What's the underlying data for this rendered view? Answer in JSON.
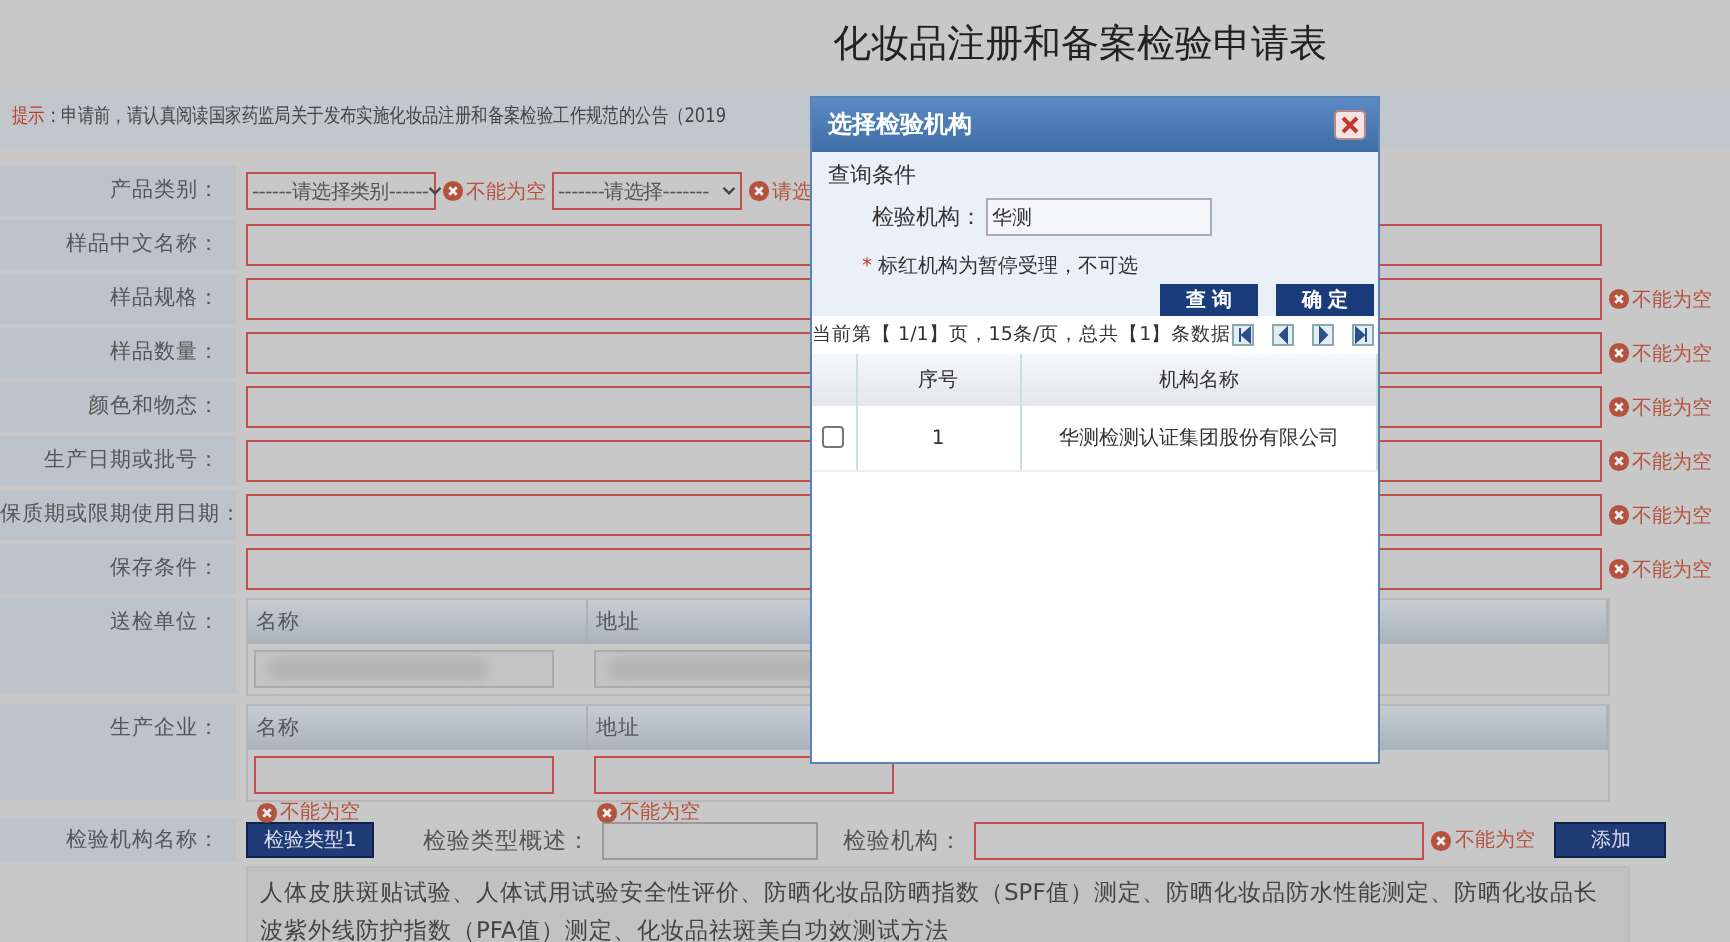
{
  "title": "化妆品注册和备案检验申请表",
  "notice": {
    "label": "提示",
    "text": "：申请前，请认真阅读国家药监局关于发布实施化妆品注册和备案检验工作规范的公告（2019"
  },
  "form_rows": [
    {
      "kind": "selects",
      "label": "产品类别：",
      "selects": [
        {
          "value": "------请选择类别------",
          "error": "不能为空"
        },
        {
          "value": "-------请选择-------",
          "error": "请选"
        }
      ]
    },
    {
      "kind": "input",
      "label": "样品中文名称："
    },
    {
      "kind": "input",
      "label": "样品规格：",
      "error": "不能为空"
    },
    {
      "kind": "input",
      "label": "样品数量：",
      "error": "不能为空"
    },
    {
      "kind": "input",
      "label": "颜色和物态：",
      "error": "不能为空"
    },
    {
      "kind": "input",
      "label": "生产日期或批号：",
      "error": "不能为空"
    },
    {
      "kind": "input",
      "label": "保质期或限期使用日期：",
      "error": "不能为空"
    },
    {
      "kind": "input",
      "label": "保存条件：",
      "error": "不能为空"
    },
    {
      "kind": "subtable",
      "label": "送检单位：",
      "columns": [
        "名称",
        "地址"
      ],
      "cells": [
        {
          "blurred": true
        },
        {
          "blurred": true
        }
      ]
    },
    {
      "kind": "subtable",
      "label": "生产企业：",
      "columns": [
        "名称",
        "地址"
      ],
      "cells": [
        {
          "blurred": false,
          "error": "不能为空"
        },
        {
          "blurred": false,
          "error": "不能为空"
        }
      ]
    }
  ],
  "inspection_row": {
    "label": "检验机构名称：",
    "type_button": "检验类型1",
    "summary_label": "检验类型概述：",
    "agency_label": "检验机构：",
    "agency_error": "不能为空",
    "add_button": "添加"
  },
  "description": "人体皮肤斑贴试验、人体试用试验安全性评价、防晒化妆品防晒指数（SPF值）测定、防晒化妆品防水性能测定、防晒化妆品长波紫外线防护指数（PFA值）测定、化妆品祛斑美白功效测试方法",
  "dialog": {
    "title": "选择检验机构",
    "section": "查询条件",
    "field_label": "检验机构：",
    "field_value": "华测",
    "note_mark": "*",
    "note": "标红机构为暂停受理，不可选",
    "query_button": "查 询",
    "confirm_button": "确 定",
    "pager": "当前第【 1/1】页，15条/页，总共【1】条数据",
    "columns": [
      "序号",
      "机构名称"
    ],
    "rows": [
      {
        "checked": false,
        "index": "1",
        "name": "华测检测认证集团股份有限公司"
      }
    ]
  }
}
